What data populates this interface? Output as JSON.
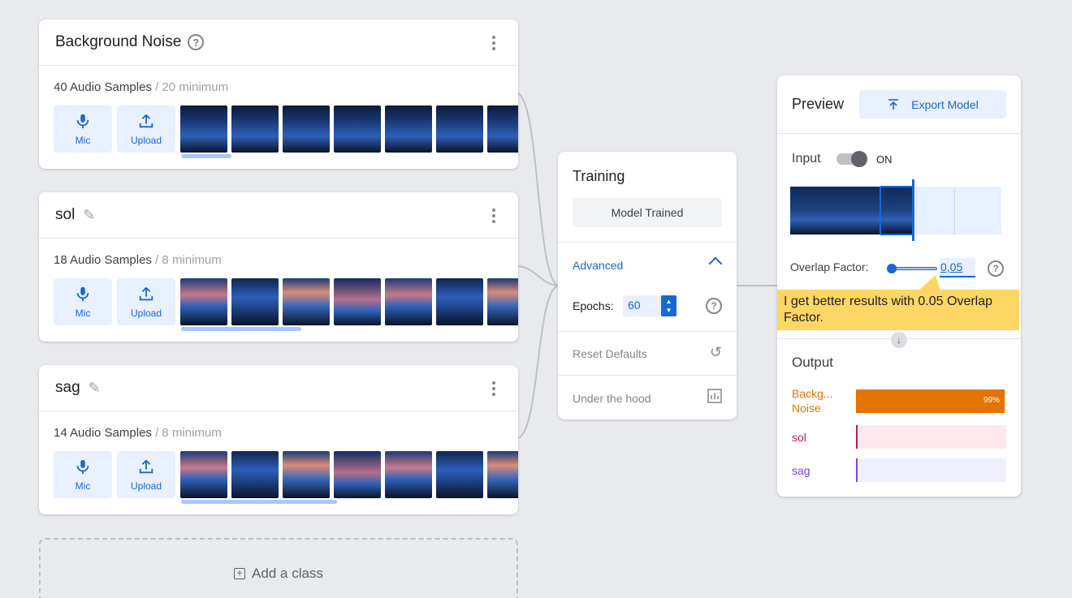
{
  "classes": [
    {
      "title": "Background Noise",
      "count": "40 Audio Samples",
      "minimum": "/ 20 minimum",
      "mic_label": "Mic",
      "upload_label": "Upload",
      "thumb_variant": "noise"
    },
    {
      "title": "sol",
      "count": "18 Audio Samples",
      "minimum": "/ 8 minimum",
      "mic_label": "Mic",
      "upload_label": "Upload",
      "thumb_variant": "warm"
    },
    {
      "title": "sag",
      "count": "14 Audio Samples",
      "minimum": "/ 8 minimum",
      "mic_label": "Mic",
      "upload_label": "Upload",
      "thumb_variant": "warm"
    }
  ],
  "add_class_label": "Add a class",
  "training": {
    "title": "Training",
    "button_label": "Model Trained",
    "advanced_label": "Advanced",
    "epochs_label": "Epochs:",
    "epochs_value": "60",
    "reset_label": "Reset Defaults",
    "under_hood_label": "Under the hood"
  },
  "preview": {
    "title": "Preview",
    "export_label": "Export Model",
    "input_label": "Input",
    "toggle_state": "ON",
    "overlap_label": "Overlap Factor:",
    "overlap_value": "0,05",
    "tooltip": "I get better results with 0.05 Overlap Factor.",
    "output_label": "Output",
    "outputs": [
      {
        "name_line1": "Backg...",
        "name_line2": "Noise",
        "percent": 0.99,
        "percent_label": "99%",
        "color": "#e37400",
        "bg": "#fde7d0"
      },
      {
        "name_line1": "sol",
        "name_line2": "",
        "percent": 0.0,
        "percent_label": "",
        "color": "#c2185b",
        "bg": "#fde8ec"
      },
      {
        "name_line1": "sag",
        "name_line2": "",
        "percent": 0.0,
        "percent_label": "",
        "color": "#7b3ff2",
        "bg": "#f0effd"
      }
    ]
  },
  "colors": {
    "accent": "#1967d2",
    "accent_light": "#e8f0fe",
    "tooltip_bg": "#fdd663"
  }
}
